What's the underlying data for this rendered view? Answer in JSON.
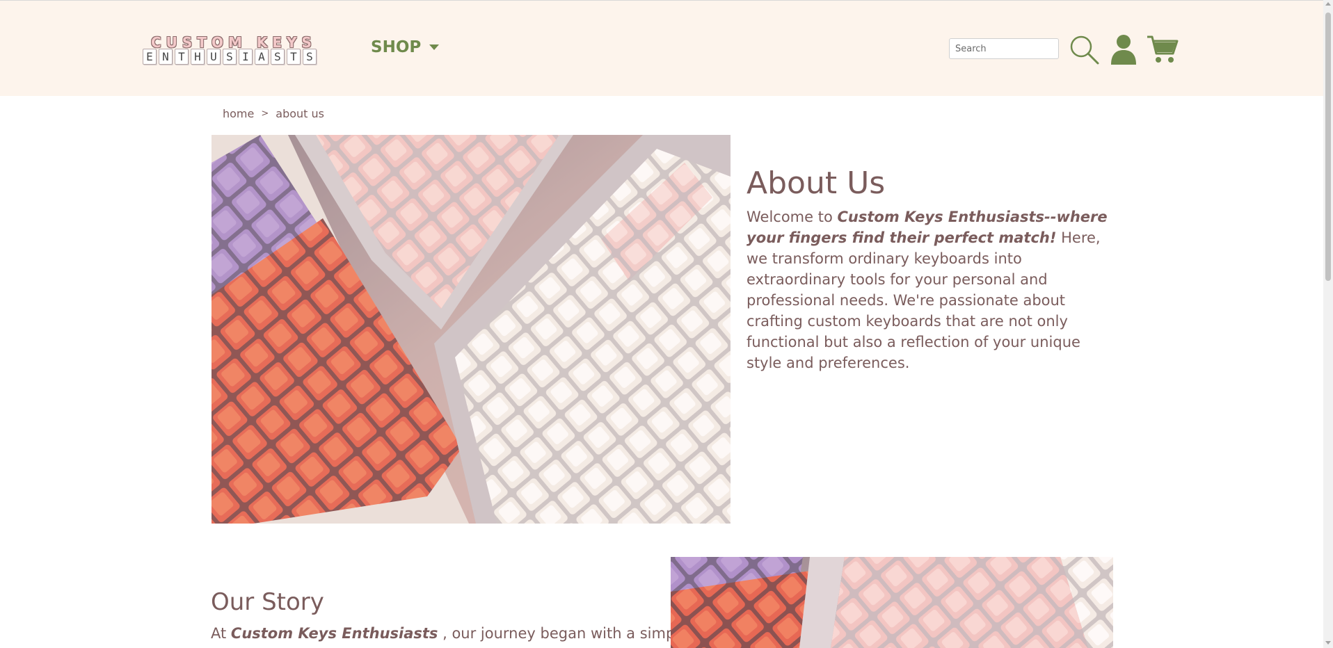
{
  "header": {
    "logo": {
      "line1": "CUSTOM KEYS",
      "line2_letters": [
        "E",
        "N",
        "T",
        "H",
        "U",
        "S",
        "I",
        "A",
        "S",
        "T",
        "S"
      ]
    },
    "nav": {
      "shop_label": "SHOP"
    },
    "search": {
      "placeholder": "Search",
      "value": ""
    },
    "icons": {
      "search": "search-icon",
      "user": "user-icon",
      "cart": "cart-icon"
    },
    "colors": {
      "background": "#fdf4ec",
      "accent_green": "#6f8a4c"
    }
  },
  "breadcrumb": {
    "home": "home",
    "separator": ">",
    "current": "about us"
  },
  "about": {
    "title": "About Us",
    "intro_plain": "Welcome to ",
    "intro_bold": "Custom Keys Enthusiasts--where your fingers find their perfect match!",
    "body": " Here, we transform ordinary keyboards into extraordinary tools for your personal and professional needs. We're passionate about crafting custom keyboards that are not only functional but also a reflection of your unique style and preferences."
  },
  "story": {
    "title": "Our Story",
    "text_plain_1": "At ",
    "text_bold": "Custom Keys Enthusiasts",
    "text_plain_2": " , our journey began with a simple"
  },
  "colors": {
    "text": "#7a5c5c"
  }
}
